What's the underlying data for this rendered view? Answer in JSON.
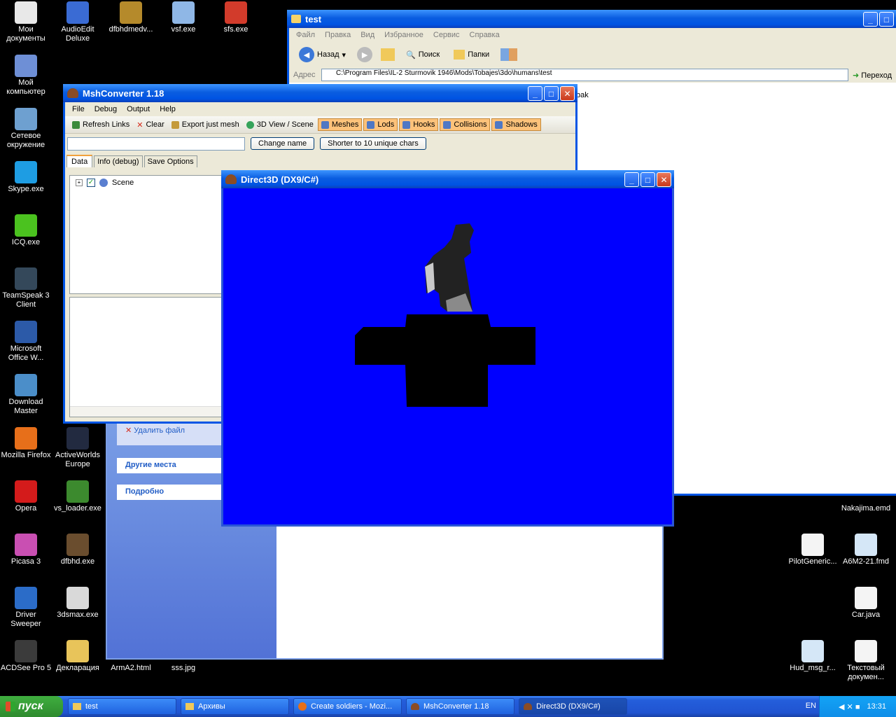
{
  "desktop": {
    "icons": [
      {
        "label": "Мои документы",
        "color": "#e8e8e8"
      },
      {
        "label": "AudioEdit Deluxe",
        "color": "#3a6bd4"
      },
      {
        "label": "dfbhdmedv...",
        "color": "#b58a2b"
      },
      {
        "label": "vsf.exe",
        "color": "#8fb7e6"
      },
      {
        "label": "sfs.exe",
        "color": "#d23b2b"
      },
      {
        "label": "Мой компьютер",
        "color": "#6e8fd6"
      },
      {
        "label": "Сетевое окружение",
        "color": "#6ea0d0"
      },
      {
        "label": "Skype.exe",
        "color": "#1e9de3"
      },
      {
        "label": "ICQ.exe",
        "color": "#4bc21f"
      },
      {
        "label": "TeamSpeak 3 Client",
        "color": "#34485a"
      },
      {
        "label": "Microsoft Office W...",
        "color": "#2c5aa8"
      },
      {
        "label": "Download Master",
        "color": "#4b8ec9"
      },
      {
        "label": "Mozilla Firefox",
        "color": "#e76f1a"
      },
      {
        "label": "ActiveWorlds Europe",
        "color": "#222a40"
      },
      {
        "label": "Opera",
        "color": "#d41b1b"
      },
      {
        "label": "vs_loader.exe",
        "color": "#3c8a2e"
      },
      {
        "label": "Picasa 3",
        "color": "#c94fb2"
      },
      {
        "label": "dfbhd.exe",
        "color": "#6a4d2e"
      },
      {
        "label": "Driver Sweeper",
        "color": "#2b6cc8"
      },
      {
        "label": "3dsmax.exe",
        "color": "#d9d9d9"
      },
      {
        "label": "ACDSee Pro 5",
        "color": "#3b3b3b"
      },
      {
        "label": "Декларация",
        "color": "#e8c45a"
      },
      {
        "label": "ArmA2.html",
        "color": "#000"
      },
      {
        "label": "sss.jpg",
        "color": "#000"
      },
      {
        "label": "Nakajima.emd",
        "color": "#000"
      },
      {
        "label": "PilotGeneric...",
        "color": "#f4f4f4"
      },
      {
        "label": "A6M2-21.fmd",
        "color": "#d5e7f7"
      },
      {
        "label": "Car.java",
        "color": "#f4f4f4"
      },
      {
        "label": "Hud_msg_r...",
        "color": "#d5e7f7"
      },
      {
        "label": "Текстовый докумен...",
        "color": "#f4f4f4"
      }
    ]
  },
  "explorer": {
    "title": "test",
    "menu": [
      "Файл",
      "Правка",
      "Вид",
      "Избранное",
      "Сервис",
      "Справка"
    ],
    "back": "Назад",
    "search": "Поиск",
    "folders": "Папки",
    "address_label": "Адрес",
    "address_value": "C:\\Program Files\\IL-2 Sturmovik 1946\\Mods\\Tobajes\\3do\\humans\\test",
    "go": "Переход",
    "file_fragment": "bak",
    "delete_file": "Удалить файл",
    "other_places": "Другие места",
    "details": "Подробно"
  },
  "msh": {
    "title": "MshConverter 1.18",
    "menu": [
      "File",
      "Debug",
      "Output",
      "Help"
    ],
    "toolbar": [
      "Refresh Links",
      "Clear",
      "Export just mesh",
      "3D View / Scene"
    ],
    "toggles": [
      "Meshes",
      "Lods",
      "Hooks",
      "Collisions",
      "Shadows"
    ],
    "name_input": "",
    "change_name": "Change name",
    "shorter": "Shorter to 10 unique chars",
    "tabs": [
      "Data",
      "Info (debug)",
      "Save Options"
    ],
    "tree_root": "Scene"
  },
  "d3d": {
    "title": "Direct3D (DX9/C#)",
    "bg": "#0000ff"
  },
  "taskbar": {
    "start": "пуск",
    "tasks": [
      "test",
      "Архивы",
      "Create soldiers - Mozi...",
      "MshConverter 1.18",
      "Direct3D (DX9/C#)"
    ],
    "lang": "EN",
    "clock": "13:31"
  }
}
